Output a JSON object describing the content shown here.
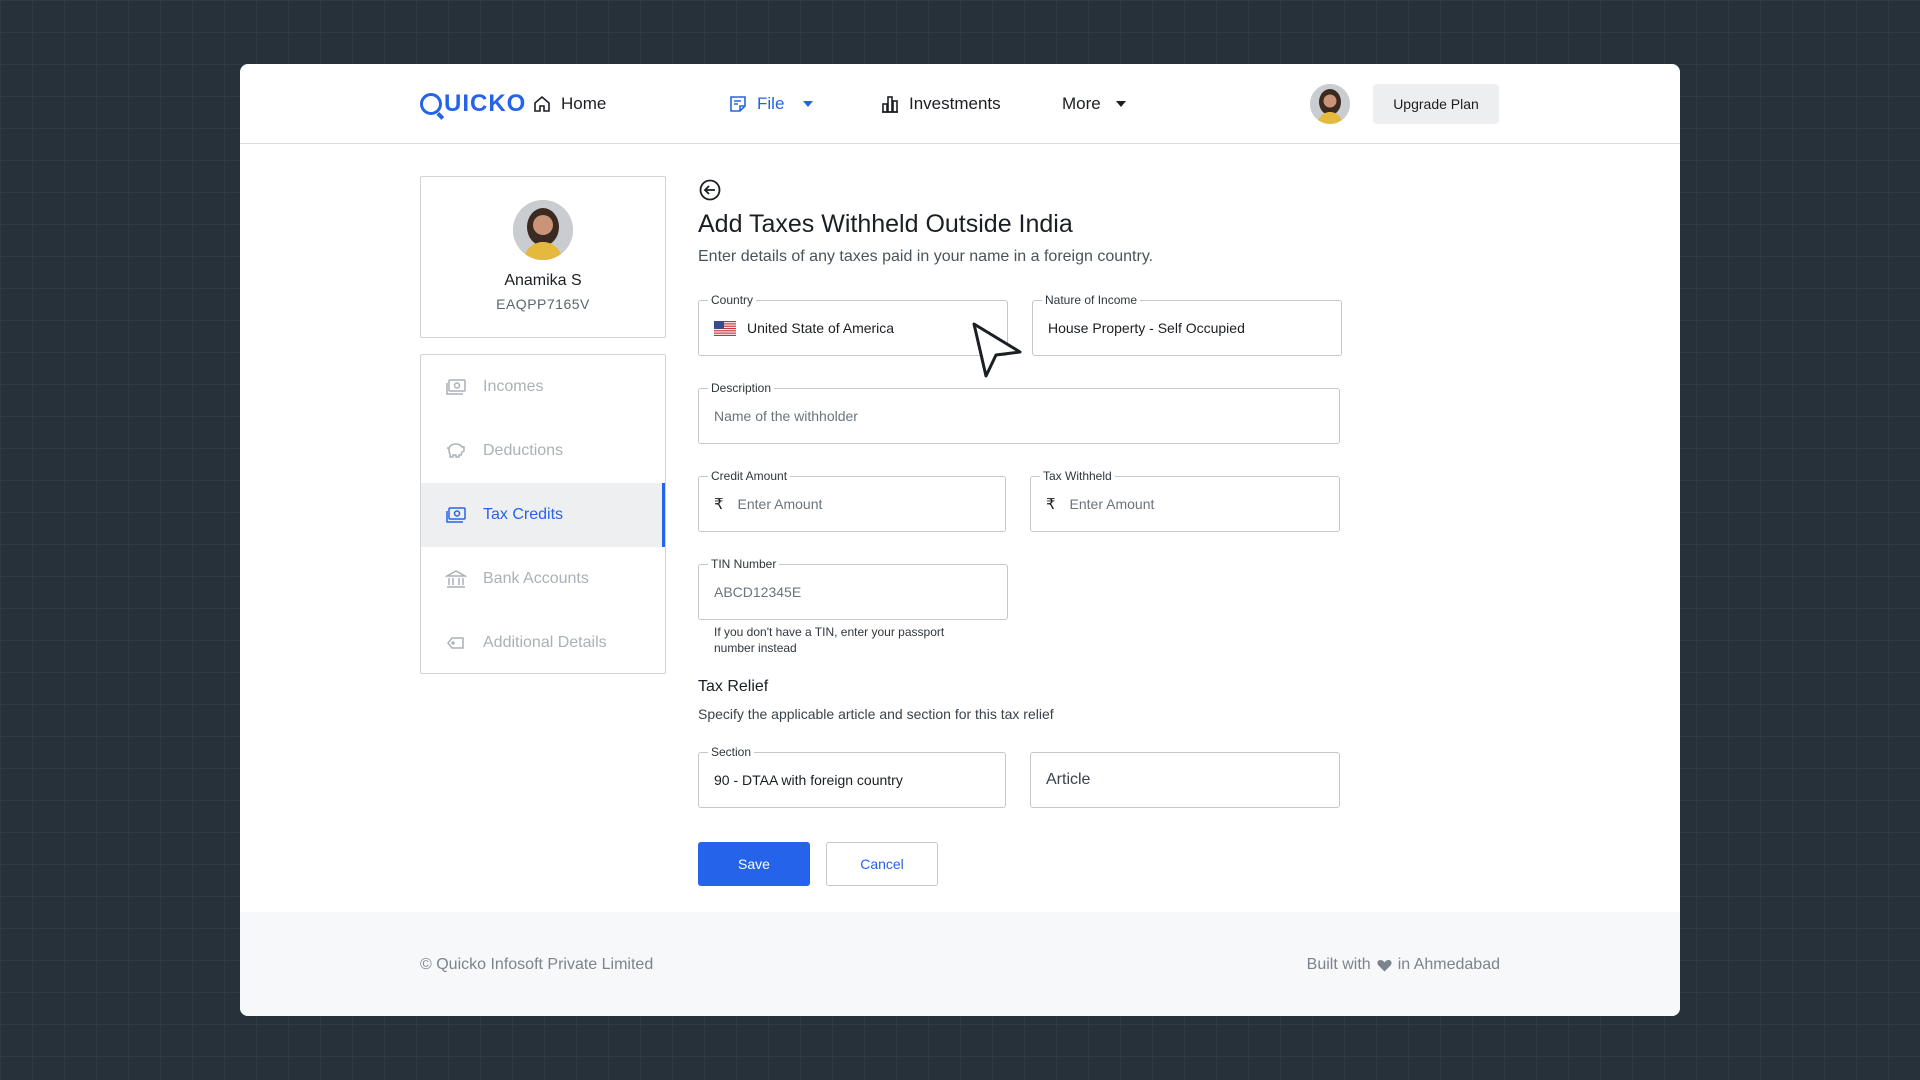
{
  "header": {
    "logo": "QUICKO",
    "nav": [
      {
        "label": "Home",
        "icon": "home-icon"
      },
      {
        "label": "File",
        "icon": "file-icon"
      },
      {
        "label": "Investments",
        "icon": "investments-icon"
      },
      {
        "label": "More"
      }
    ],
    "upgrade_label": "Upgrade Plan"
  },
  "profile": {
    "name": "Anamika S",
    "pan": "EAQPP7165V"
  },
  "sidebar": {
    "items": [
      {
        "label": "Incomes",
        "icon": "incomes-icon"
      },
      {
        "label": "Deductions",
        "icon": "piggy-bank-icon"
      },
      {
        "label": "Tax Credits",
        "icon": "tax-credits-icon",
        "active": true
      },
      {
        "label": "Bank Accounts",
        "icon": "bank-icon"
      },
      {
        "label": "Additional Details",
        "icon": "tag-icon"
      }
    ]
  },
  "form": {
    "title": "Add Taxes Withheld Outside India",
    "subtitle": "Enter details of any taxes paid in your name in a foreign country.",
    "country": {
      "label": "Country",
      "value": "United State of America"
    },
    "nature": {
      "label": "Nature of Income",
      "value": "House Property - Self Occupied"
    },
    "description": {
      "label": "Description",
      "placeholder": "Name of the withholder"
    },
    "credit_amount": {
      "label": "Credit Amount",
      "currency": "₹",
      "placeholder": "Enter Amount"
    },
    "tax_withheld": {
      "label": "Tax Withheld",
      "currency": "₹",
      "placeholder": "Enter Amount"
    },
    "tin": {
      "label": "TIN Number",
      "placeholder": "ABCD12345E",
      "hint": "If you don't have a TIN, enter your passport number instead"
    },
    "relief": {
      "title": "Tax Relief",
      "subtitle": "Specify the applicable article and section for this tax relief",
      "section": {
        "label": "Section",
        "value": "90 - DTAA with foreign country"
      },
      "article": {
        "placeholder": "Article"
      }
    },
    "save_label": "Save",
    "cancel_label": "Cancel"
  },
  "footer": {
    "copyright": "© Quicko Infosoft Private Limited",
    "built_prefix": "Built with",
    "built_suffix": "in Ahmedabad"
  },
  "colors": {
    "accent": "#2563eb",
    "background": "#26313a"
  }
}
